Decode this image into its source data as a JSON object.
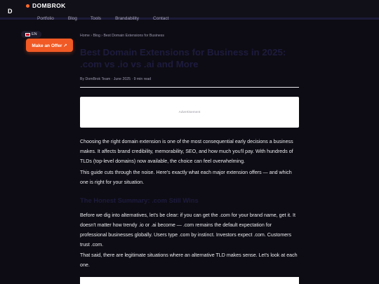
{
  "header": {
    "side_letter": "D",
    "brand": "DOMBROK",
    "nav": [
      "Portfolio",
      "Blog",
      "Tools",
      "Brandability",
      "Contact"
    ]
  },
  "sidebar": {
    "language": "EN",
    "offer_button": "Make an Offer ↗"
  },
  "article": {
    "breadcrumb": "Home › Blog › Best Domain Extensions for Business",
    "title": "Best Domain Extensions for Business in 2025: .com vs .io vs .ai and More",
    "meta": "By DomBrok Team  ·  June 2025  ·  9 min read",
    "ad_label": "Advertisement",
    "paragraphs": [
      "Choosing the right domain extension is one of the most consequential early decisions a business makes. It affects brand credibility, memorability, SEO, and how much you'll pay. With hundreds of TLDs (top-level domains) now available, the choice can feel overwhelming.",
      "This guide cuts through the noise. Here's exactly what each major extension offers — and which one is right for your situation."
    ],
    "section_heading": "The Honest Summary: .com Still Wins",
    "section_paragraphs": [
      "Before we dig into alternatives, let's be clear: if you can get the .com for your brand name, get it. It doesn't matter how trendy .io or .ai become — .com remains the default expectation for professional businesses globally. Users type .com by instinct. Investors expect .com. Customers trust .com.",
      "That said, there are legitimate situations where an alternative TLD makes sense. Let's look at each one."
    ]
  },
  "colors": {
    "accent": "#f15a24",
    "background": "#0d0c14",
    "heading": "#1d1b3d"
  }
}
